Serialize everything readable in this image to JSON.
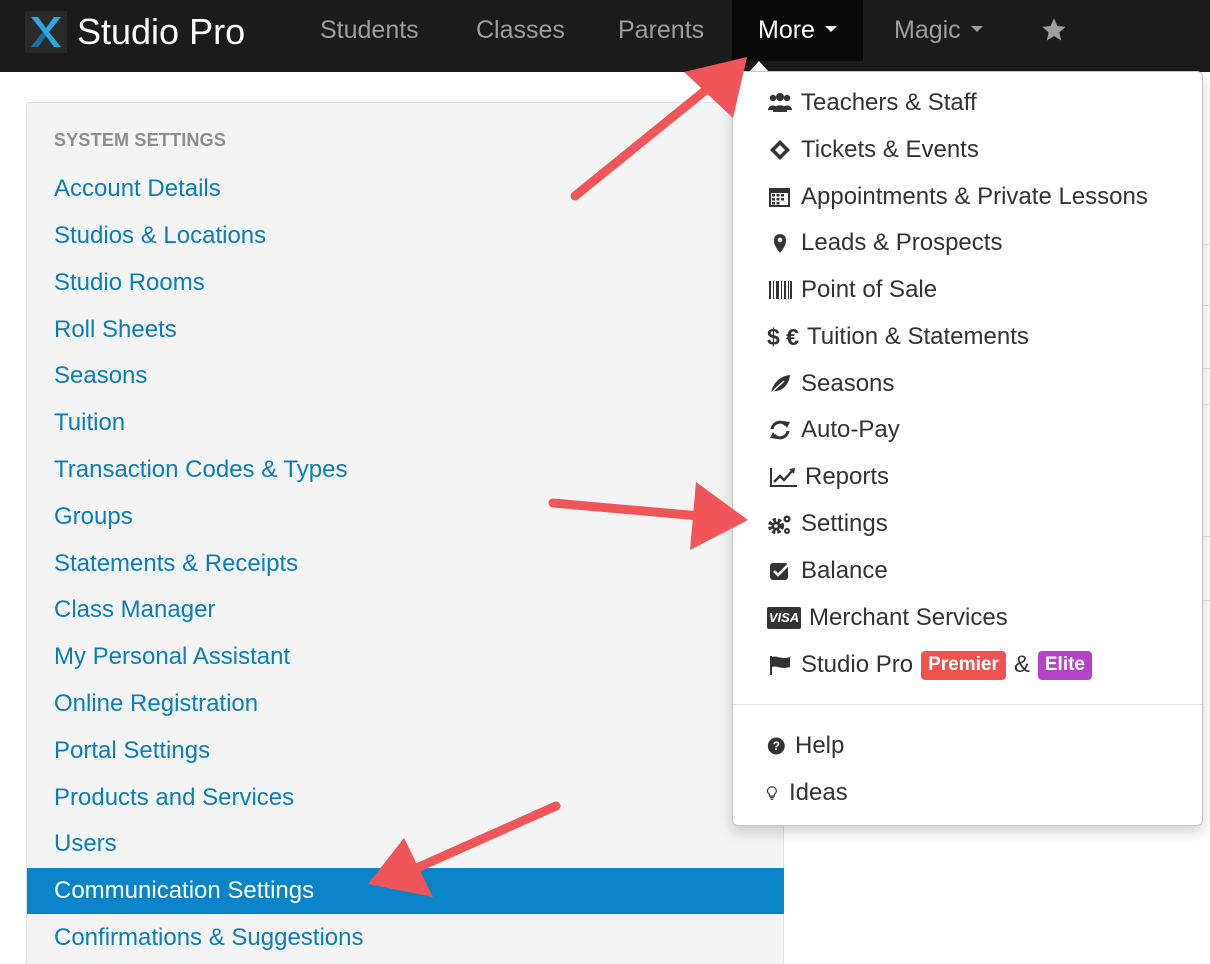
{
  "navbar": {
    "brand": "Studio Pro",
    "items": [
      {
        "label": "Students"
      },
      {
        "label": "Classes"
      },
      {
        "label": "Parents"
      },
      {
        "label": "More"
      },
      {
        "label": "Magic"
      }
    ],
    "icons": [
      "studio-pro-logo",
      "caret-down",
      "star"
    ]
  },
  "sidebar": {
    "heading": "SYSTEM SETTINGS",
    "items": [
      {
        "label": "Account Details"
      },
      {
        "label": "Studios & Locations"
      },
      {
        "label": "Studio Rooms"
      },
      {
        "label": "Roll Sheets"
      },
      {
        "label": "Seasons"
      },
      {
        "label": "Tuition"
      },
      {
        "label": "Transaction Codes & Types"
      },
      {
        "label": "Groups"
      },
      {
        "label": "Statements & Receipts"
      },
      {
        "label": "Class Manager"
      },
      {
        "label": "My Personal Assistant"
      },
      {
        "label": "Online Registration"
      },
      {
        "label": "Portal Settings"
      },
      {
        "label": "Products and Services"
      },
      {
        "label": "Users"
      },
      {
        "label": "Communication Settings",
        "active": true
      },
      {
        "label": "Confirmations & Suggestions"
      }
    ]
  },
  "more_menu": {
    "items": [
      {
        "label": "Teachers & Staff",
        "icon": "users-icon"
      },
      {
        "label": "Tickets & Events",
        "icon": "ticket-icon"
      },
      {
        "label": "Appointments & Private Lessons",
        "icon": "calendar-icon"
      },
      {
        "label": "Leads & Prospects",
        "icon": "map-marker-icon"
      },
      {
        "label": "Point of Sale",
        "icon": "barcode-icon"
      },
      {
        "label": "Tuition & Statements",
        "icon": "dollar-euro-icon",
        "icon_text": "$ €"
      },
      {
        "label": "Seasons",
        "icon": "leaf-icon"
      },
      {
        "label": "Auto-Pay",
        "icon": "refresh-icon"
      },
      {
        "label": "Reports",
        "icon": "line-chart-icon"
      },
      {
        "label": "Settings",
        "icon": "cogs-icon"
      },
      {
        "label": "Balance",
        "icon": "check-square-icon"
      },
      {
        "label": "Merchant Services",
        "icon": "visa-icon",
        "icon_text": "VISA"
      },
      {
        "label": "Studio Pro",
        "icon": "flag-icon",
        "badges": [
          "Premier",
          "Elite"
        ],
        "joiner": "&"
      }
    ],
    "footer_items": [
      {
        "label": "Help",
        "icon": "question-circle-icon"
      },
      {
        "label": "Ideas",
        "icon": "lightbulb-icon"
      }
    ]
  },
  "colors": {
    "navbar": "#1b1b1b",
    "link": "#0a7dbb",
    "active_row": "#0a84c8",
    "badge_premier": "#ef5350",
    "badge_elite": "#b443c7",
    "annotation_arrow": "#f0555a"
  },
  "annotations": [
    "arrow-to-more-menu",
    "arrow-to-settings",
    "arrow-to-communication-settings"
  ]
}
